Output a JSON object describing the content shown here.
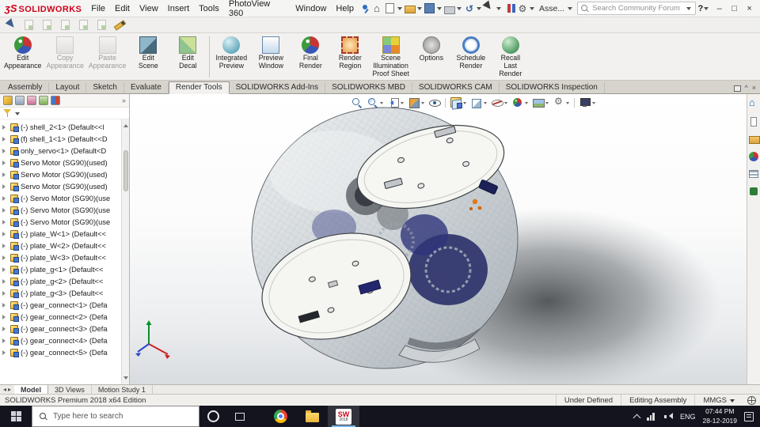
{
  "titlebar": {
    "logo_mark": "ʒS",
    "logo_text": "SOLIDWORKS",
    "menus": [
      "File",
      "Edit",
      "View",
      "Insert",
      "Tools",
      "PhotoView 360",
      "Window",
      "Help"
    ],
    "quick_icons": [
      {
        "name": "home",
        "caret": false
      },
      {
        "name": "new-doc",
        "caret": true
      },
      {
        "name": "open",
        "caret": true
      },
      {
        "name": "save",
        "caret": true
      },
      {
        "name": "print",
        "caret": true
      },
      {
        "name": "undo",
        "caret": true
      },
      {
        "name": "select",
        "caret": true
      },
      {
        "name": "resources",
        "caret": false
      },
      {
        "name": "settings",
        "caret": true
      }
    ],
    "document_label": "Asse...",
    "search_placeholder": "Search Community Forum",
    "help_label": "?",
    "window_buttons": {
      "minimize": "–",
      "maximize": "□",
      "close": "×"
    }
  },
  "quickbar": {
    "icons": [
      {
        "name": "select-arrow",
        "disabled": false
      },
      {
        "name": "doc-tool-1",
        "disabled": true
      },
      {
        "name": "doc-tool-2",
        "disabled": true
      },
      {
        "name": "doc-tool-3",
        "disabled": true
      },
      {
        "name": "doc-tool-4",
        "disabled": true
      },
      {
        "name": "doc-tool-5",
        "disabled": true
      },
      {
        "name": "pencil",
        "disabled": false
      }
    ]
  },
  "ribbon": {
    "buttons": [
      {
        "name": "edit-appearance",
        "label": "Edit\nAppearance",
        "icon": "appearance-sphere",
        "disabled": false
      },
      {
        "name": "copy-appearance",
        "label": "Copy\nAppearance",
        "icon": "copy-appearance",
        "disabled": true
      },
      {
        "name": "paste-appearance",
        "label": "Paste\nAppearance",
        "icon": "paste-appearance",
        "disabled": true
      },
      {
        "name": "edit-scene",
        "label": "Edit\nScene",
        "icon": "edit-scene",
        "disabled": false
      },
      {
        "name": "edit-decal",
        "label": "Edit\nDecal",
        "icon": "edit-decal",
        "disabled": false
      },
      {
        "sep": true
      },
      {
        "name": "integrated-preview",
        "label": "Integrated\nPreview",
        "icon": "integrated-preview",
        "disabled": false
      },
      {
        "name": "preview-window",
        "label": "Preview\nWindow",
        "icon": "preview-window",
        "disabled": false
      },
      {
        "name": "final-render",
        "label": "Final\nRender",
        "icon": "final-render",
        "disabled": false
      },
      {
        "name": "render-region",
        "label": "Render\nRegion",
        "icon": "render-region",
        "disabled": false
      },
      {
        "name": "scene-illumination-proof-sheet",
        "label": "Scene\nIllumination\nProof Sheet",
        "icon": "proof-sheet",
        "disabled": false
      },
      {
        "name": "options",
        "label": "Options",
        "icon": "options",
        "disabled": false
      },
      {
        "name": "schedule-render",
        "label": "Schedule\nRender",
        "icon": "schedule-render",
        "disabled": false
      },
      {
        "name": "recall-last-render",
        "label": "Recall\nLast\nRender",
        "icon": "recall-render",
        "disabled": false
      }
    ]
  },
  "tabs": {
    "items": [
      {
        "label": "Assembly",
        "active": false
      },
      {
        "label": "Layout",
        "active": false
      },
      {
        "label": "Sketch",
        "active": false
      },
      {
        "label": "Evaluate",
        "active": false
      },
      {
        "label": "Render Tools",
        "active": true
      },
      {
        "label": "SOLIDWORKS Add-Ins",
        "active": false
      },
      {
        "label": "SOLIDWORKS MBD",
        "active": false
      },
      {
        "label": "SOLIDWORKS CAM",
        "active": false
      },
      {
        "label": "SOLIDWORKS Inspection",
        "active": false
      }
    ]
  },
  "feature_panel": {
    "header_tabs": [
      "featuremanager",
      "propertymanager",
      "configurationmanager",
      "dimxpertmanager",
      "displaymanager"
    ],
    "chevron": "»",
    "items": [
      "(-) shell_2<1> (Default<<I",
      "(f) shell_1<1> (Default<<D",
      "only_servo<1> (Default<D",
      "Servo Motor (SG90)(used)",
      "Servo Motor (SG90)(used)",
      "Servo Motor (SG90)(used)",
      "(-) Servo Motor (SG90)(use",
      "(-) Servo Motor (SG90)(use",
      "(-) Servo Motor (SG90)(use",
      "(-) plate_W<1> (Default<<",
      "(-) plate_W<2> (Default<<",
      "(-) plate_W<3> (Default<<",
      "(-) plate_g<1> (Default<<",
      "(-) plate_g<2> (Default<<",
      "(-) plate_g<3> (Default<<",
      "(-) gear_connect<1> (Defa",
      "(-) gear_connect<2> (Defa",
      "(-) gear_connect<3> (Defa",
      "(-) gear_connect<4> (Defa",
      "(-) gear_connect<5> (Defa"
    ]
  },
  "viewport": {
    "toolbar": [
      {
        "name": "zoom-fit",
        "icon": "mag-fit",
        "caret": false
      },
      {
        "name": "zoom-area",
        "icon": "mag-area",
        "caret": true
      },
      {
        "name": "previous-view",
        "icon": "page-prev",
        "caret": true
      },
      {
        "name": "section-view",
        "icon": "section",
        "caret": true
      },
      {
        "name": "dynamic-annotation",
        "icon": "eye",
        "caret": false
      },
      {
        "sep": true
      },
      {
        "name": "view-orientation",
        "icon": "cube",
        "caret": true
      },
      {
        "name": "display-style",
        "icon": "displaystyle",
        "caret": true
      },
      {
        "name": "hide-show-items",
        "icon": "hide",
        "caret": true
      },
      {
        "name": "edit-appearance",
        "icon": "sphere",
        "caret": true
      },
      {
        "name": "apply-scene",
        "icon": "scene",
        "caret": true
      },
      {
        "name": "view-settings",
        "icon": "gear",
        "caret": true
      },
      {
        "sep": true
      },
      {
        "name": "camera",
        "icon": "monitor",
        "caret": true
      }
    ]
  },
  "taskpane": {
    "icons": [
      "home",
      "knowledge",
      "files",
      "appearances",
      "properties",
      "forum"
    ]
  },
  "doc_tabs": {
    "items": [
      {
        "label": "Model",
        "active": true
      },
      {
        "label": "3D Views",
        "active": false
      },
      {
        "label": "Motion Study 1",
        "active": false
      }
    ]
  },
  "statusbar": {
    "left": "SOLIDWORKS Premium 2018 x64 Edition",
    "cells": [
      {
        "label": "Under Defined",
        "caret": false
      },
      {
        "label": "Editing Assembly",
        "caret": false
      },
      {
        "label": "MMGS",
        "caret": true
      }
    ]
  },
  "taskbar": {
    "search_placeholder": "Type here to search",
    "apps": [
      {
        "name": "chrome",
        "active": false
      },
      {
        "name": "file-explorer",
        "active": false
      },
      {
        "name": "solidworks",
        "active": true,
        "label": "SW",
        "sub": "2018"
      }
    ],
    "tray_language": "ENG",
    "time": "07:44 PM",
    "date": "28-12-2019"
  }
}
